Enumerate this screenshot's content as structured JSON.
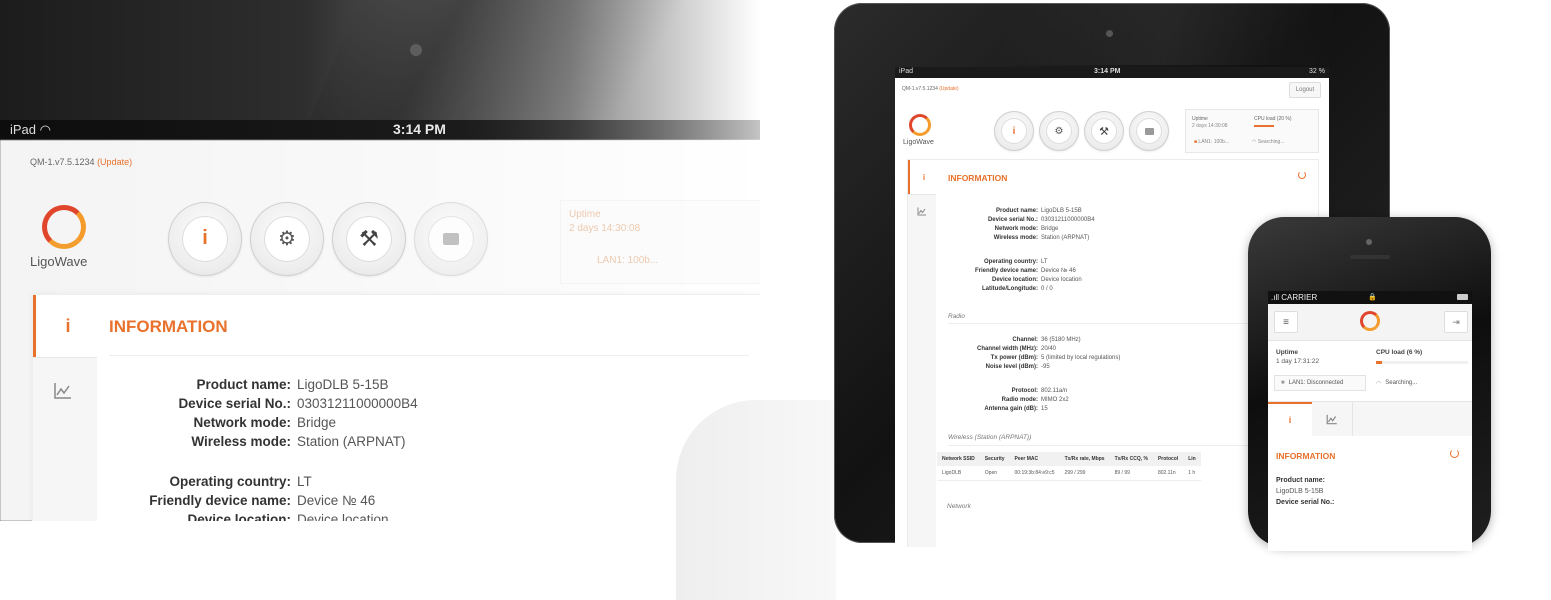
{
  "status_bar": {
    "carrier": "iPad",
    "time": "3:14 PM",
    "battery": "32 %"
  },
  "firmware": {
    "version": "QM-1.v7.5.1234",
    "update_link": "(Update)"
  },
  "brand": {
    "logo_text": "LigoWave",
    "accent_color": "#e8712c",
    "logo_colors": [
      "#e0462b",
      "#f59b2b"
    ]
  },
  "toolbar": {
    "buttons": [
      {
        "icon": "info-icon",
        "glyph": "i"
      },
      {
        "icon": "gear-icon",
        "glyph": "⚙"
      },
      {
        "icon": "tools-icon",
        "glyph": "⚒"
      },
      {
        "icon": "briefcase-icon",
        "glyph": "💼"
      }
    ],
    "logout_label": "Logout"
  },
  "stats": {
    "uptime_label": "Uptime",
    "uptime_value": "2 days 14:30:08",
    "cpu_label": "CPU load (20 %)",
    "cpu_load_percent": 20,
    "lan_label": "LAN1: 100b...",
    "search_label": "Searching..."
  },
  "info": {
    "title": "INFORMATION",
    "rows_group1": [
      {
        "k": "Product name:",
        "v": "LigoDLB 5-15B"
      },
      {
        "k": "Device serial No.:",
        "v": "03031211000000B4"
      },
      {
        "k": "Network mode:",
        "v": "Bridge"
      },
      {
        "k": "Wireless mode:",
        "v": "Station (ARPNAT)"
      }
    ],
    "rows_group2": [
      {
        "k": "Operating country:",
        "v": "LT"
      },
      {
        "k": "Friendly device name:",
        "v": "Device № 46"
      },
      {
        "k": "Device location:",
        "v": "Device location"
      },
      {
        "k": "Latitude/Longitude:",
        "v": "0 / 0"
      }
    ],
    "radio_section": "Radio",
    "radio_rows1": [
      {
        "k": "Channel:",
        "v": "36 (5180 MHz)"
      },
      {
        "k": "Channel width (MHz):",
        "v": "20/40"
      },
      {
        "k": "Tx power (dBm):",
        "v": "5 (limited by local regulations)"
      },
      {
        "k": "Noise level (dBm):",
        "v": "-95"
      }
    ],
    "radio_rows2": [
      {
        "k": "Protocol:",
        "v": "802.11a/n"
      },
      {
        "k": "Radio mode:",
        "v": "MIMO 2x2"
      },
      {
        "k": "Antenna gain (dB):",
        "v": "15"
      }
    ],
    "wireless_section": "Wireless (Station (ARPNAT))",
    "wireless_table": {
      "headers": [
        "Network SSID",
        "Security",
        "Peer MAC",
        "Tx/Rx rate, Mbps",
        "Tx/Rx CCQ, %",
        "Protocol",
        "Lin"
      ],
      "rows": [
        [
          "LigoDLB",
          "Open",
          "00:19:3b:84:e9:c5",
          "299 / 299",
          "89 / 99",
          "802.11n",
          "1 h"
        ]
      ]
    },
    "network_section": "Network"
  },
  "phone": {
    "carrier": "CARRIER",
    "menu_glyph": "≡",
    "exit_glyph": "⇥",
    "uptime_label": "Uptime",
    "uptime_value": "1 day 17:31:22",
    "cpu_label": "CPU load (6 %)",
    "cpu_load_percent": 6,
    "lan_label": "LAN1: Disconnected",
    "search_label": "Searching...",
    "title": "INFORMATION",
    "product_label": "Product name:",
    "product_value": "LigoDLB 5-15B",
    "serial_label": "Device serial No.:"
  }
}
